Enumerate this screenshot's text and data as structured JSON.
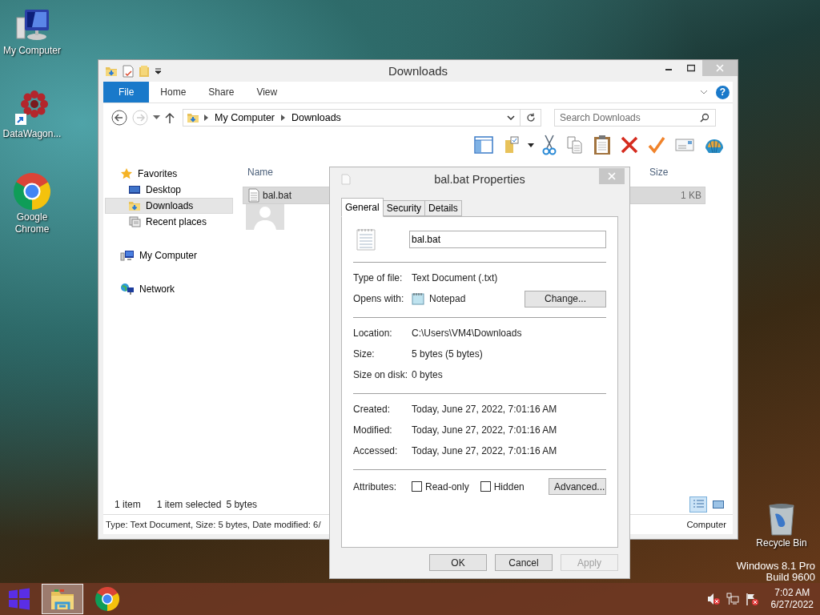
{
  "desktop": {
    "icons": [
      {
        "label": "My Computer",
        "kind": "computer"
      },
      {
        "label": "DataWagon...",
        "kind": "app"
      },
      {
        "label": "Google Chrome",
        "kind": "chrome"
      }
    ],
    "recycle_bin": {
      "label": "Recycle Bin"
    },
    "watermark": [
      "Windows 8.1 Pro",
      "Build 9600"
    ]
  },
  "explorer": {
    "title": "Downloads",
    "ribbon_tabs": [
      {
        "label": "File",
        "kind": "menu",
        "selected": false
      },
      {
        "label": "Home",
        "kind": "tab",
        "selected": false
      },
      {
        "label": "Share",
        "kind": "tab",
        "selected": false
      },
      {
        "label": "View",
        "kind": "tab",
        "selected": false
      }
    ],
    "help": "?",
    "address": [
      "My Computer",
      "Downloads"
    ],
    "search": {
      "placeholder": "Search Downloads"
    },
    "nav": [
      {
        "label": "Favorites",
        "kind": "favorites",
        "selected": false,
        "children": [
          {
            "label": "Desktop",
            "kind": "desktop",
            "selected": false
          },
          {
            "label": "Downloads",
            "kind": "downloads",
            "selected": true
          },
          {
            "label": "Recent places",
            "kind": "recent",
            "selected": false
          }
        ]
      },
      {
        "label": "My Computer",
        "kind": "computer",
        "selected": false
      },
      {
        "label": "Network",
        "kind": "network",
        "selected": false
      }
    ],
    "columns": {
      "name": "Name",
      "size": "Size"
    },
    "files": [
      {
        "name": "bal.bat",
        "size": "1 KB",
        "selected": true
      }
    ],
    "status": {
      "count": "1 item",
      "selection": "1 item selected",
      "bytes": "5 bytes"
    },
    "details": [
      "Type: Text Document, Size: 5 bytes, Date modified: 6/",
      "Computer"
    ]
  },
  "dialog": {
    "title": "bal.bat Properties",
    "tabs": [
      {
        "label": "General",
        "selected": true
      },
      {
        "label": "Security",
        "selected": false
      },
      {
        "label": "Details",
        "selected": false
      }
    ],
    "file_name": "bal.bat",
    "sections": [
      [
        {
          "label": "Type of file:",
          "value": "Text Document (.txt)",
          "kind": "text"
        },
        {
          "label": "Opens with:",
          "value": "Notepad",
          "kind": "app",
          "button": "Change..."
        }
      ],
      [
        {
          "label": "Location:",
          "value": "C:\\Users\\VM4\\Downloads",
          "kind": "text"
        },
        {
          "label": "Size:",
          "value": "5 bytes (5 bytes)",
          "kind": "text"
        },
        {
          "label": "Size on disk:",
          "value": "0 bytes",
          "kind": "text"
        }
      ],
      [
        {
          "label": "Created:",
          "value": "Today, June 27, 2022, 7:01:16 AM",
          "kind": "text"
        },
        {
          "label": "Modified:",
          "value": "Today, June 27, 2022, 7:01:16 AM",
          "kind": "text"
        },
        {
          "label": "Accessed:",
          "value": "Today, June 27, 2022, 7:01:16 AM",
          "kind": "text"
        }
      ]
    ],
    "attributes": {
      "label": "Attributes:",
      "options": [
        {
          "label": "Read-only",
          "checked": false
        },
        {
          "label": "Hidden",
          "checked": false
        }
      ],
      "button": "Advanced..."
    },
    "buttons": [
      {
        "label": "OK",
        "disabled": false
      },
      {
        "label": "Cancel",
        "disabled": false
      },
      {
        "label": "Apply",
        "disabled": true
      }
    ]
  },
  "taskbar": {
    "items": [
      {
        "kind": "start",
        "selected": false
      },
      {
        "kind": "explorer",
        "selected": true
      },
      {
        "kind": "chrome",
        "selected": false
      }
    ],
    "clock": {
      "time": "7:02 AM",
      "date": "6/27/2022"
    }
  }
}
